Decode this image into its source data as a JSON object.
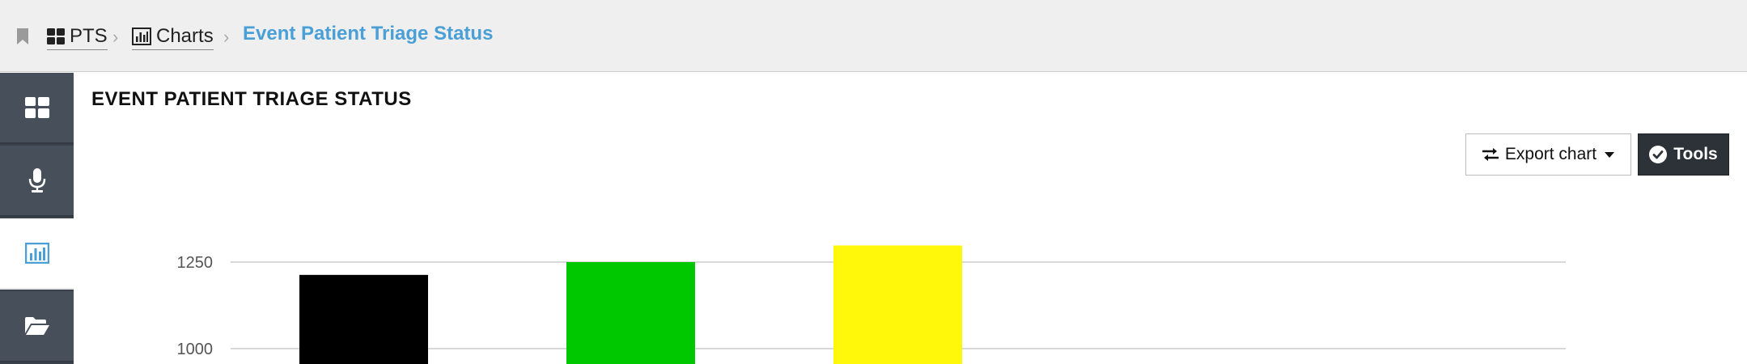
{
  "breadcrumb": {
    "items": [
      {
        "label": "PTS",
        "icon": "grid-icon"
      },
      {
        "label": "Charts",
        "icon": "bar-chart-icon"
      }
    ],
    "current": "Event Patient Triage Status"
  },
  "sidebar": {
    "items": [
      {
        "name": "dashboard",
        "icon": "grid-icon",
        "active": false
      },
      {
        "name": "microphone",
        "icon": "microphone-icon",
        "active": false
      },
      {
        "name": "charts",
        "icon": "bar-chart-icon",
        "active": true
      },
      {
        "name": "folder",
        "icon": "folder-open-icon",
        "active": false
      }
    ]
  },
  "page": {
    "title": "EVENT PATIENT TRIAGE STATUS"
  },
  "toolbar": {
    "export_label": "Export chart",
    "tools_label": "Tools"
  },
  "colors": {
    "accent": "#4a9fd6",
    "sidebar": "#474f5a",
    "tools_button": "#2d3138"
  },
  "chart_data": {
    "type": "bar",
    "categories": [
      "",
      "",
      ""
    ],
    "values": [
      1213,
      1250,
      1298
    ],
    "bar_colors": [
      "#000000",
      "#00c800",
      "#fff80a"
    ],
    "yticks": [
      1000,
      1250
    ],
    "ytick_labels": [
      "1000",
      "1250"
    ],
    "grid": true,
    "title": "",
    "xlabel": "",
    "ylabel": ""
  }
}
